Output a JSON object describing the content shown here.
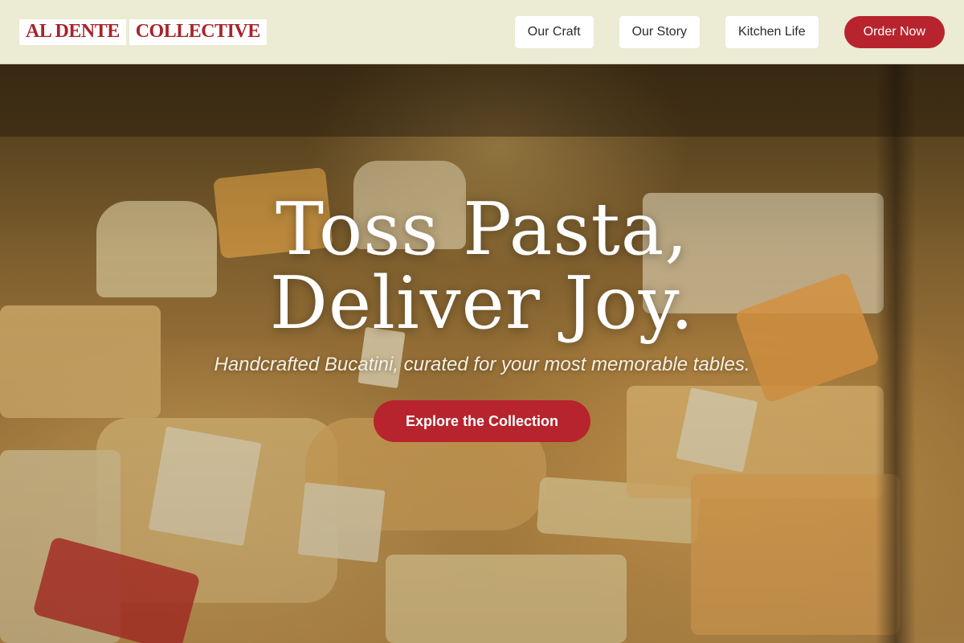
{
  "brand": {
    "word1": "AL DENTE",
    "word2": "COLLECTIVE"
  },
  "nav": {
    "items": [
      {
        "label": "Our Craft"
      },
      {
        "label": "Our Story"
      },
      {
        "label": "Kitchen Life"
      }
    ],
    "order_label": "Order Now"
  },
  "hero": {
    "headline_line1": "Toss Pasta,",
    "headline_line2": "Deliver Joy.",
    "subtitle": "Handcrafted Bucatini, curated for your most memorable tables.",
    "cta_label": "Explore the Collection"
  },
  "colors": {
    "accent": "#b7242d",
    "header_bg": "#ecebd3",
    "text_light": "#ffffff"
  }
}
